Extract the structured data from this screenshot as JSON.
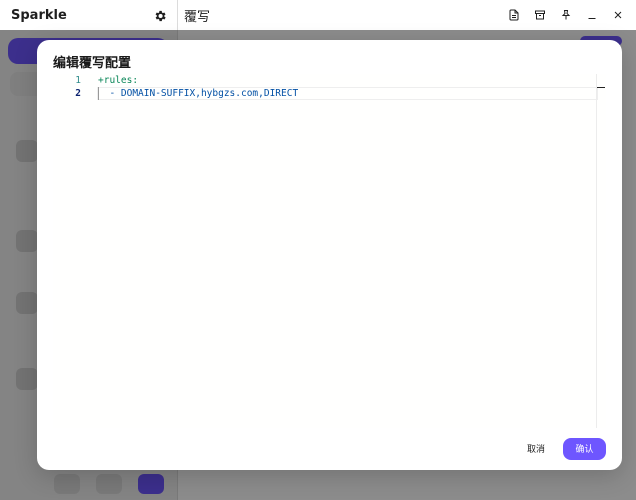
{
  "app": {
    "name": "Sparkle",
    "page_title": "覆写",
    "accent_color": "#6e56ff",
    "top_actions": [
      {
        "icon": "file-text-icon"
      },
      {
        "icon": "archive-icon"
      },
      {
        "icon": "pin-icon"
      },
      {
        "icon": "minimize-icon"
      },
      {
        "icon": "close-icon"
      }
    ]
  },
  "dialog": {
    "title": "编辑覆写配置",
    "editor": {
      "current_line": 2,
      "lines": [
        {
          "number": "1",
          "text": "+rules:"
        },
        {
          "number": "2",
          "text": "  - DOMAIN-SUFFIX,hybgzs.com,DIRECT"
        }
      ]
    },
    "cancel_label": "取消",
    "confirm_label": "确认"
  }
}
